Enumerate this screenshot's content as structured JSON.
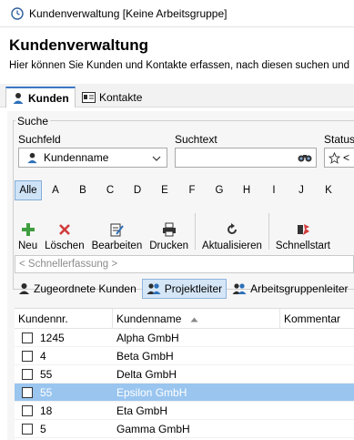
{
  "window": {
    "title": "Kundenverwaltung [Keine Arbeitsgruppe]",
    "icon": "clock-icon"
  },
  "header": {
    "title": "Kundenverwaltung",
    "subtitle": "Hier können Sie Kunden und Kontakte erfassen, nach diesen suchen und"
  },
  "tabs": [
    {
      "label": "Kunden",
      "icon": "customer-icon",
      "active": true
    },
    {
      "label": "Kontakte",
      "icon": "contact-card-icon",
      "active": false
    }
  ],
  "search": {
    "group_label": "Suche",
    "field_label": "Suchfeld",
    "field_value": "Kundenname",
    "text_label": "Suchtext",
    "text_value": "",
    "status_label": "Status",
    "status_value": "<"
  },
  "alphabet": {
    "items": [
      "Alle",
      "A",
      "B",
      "C",
      "D",
      "E",
      "F",
      "G",
      "H",
      "I",
      "J",
      "K"
    ],
    "active": "Alle"
  },
  "toolbar": {
    "new": "Neu",
    "delete": "Löschen",
    "edit": "Bearbeiten",
    "print": "Drucken",
    "refresh": "Aktualisieren",
    "quickstart": "Schnellstart"
  },
  "quickentry": {
    "placeholder": "< Schnellerfassung >"
  },
  "views": [
    {
      "label": "Zugeordnete Kunden",
      "active": false
    },
    {
      "label": "Projektleiter",
      "active": true
    },
    {
      "label": "Arbeitsgruppenleiter",
      "active": false
    }
  ],
  "table": {
    "columns": [
      "Kundennr.",
      "Kundenname",
      "Kommentar"
    ],
    "sort_column": "Kundenname",
    "rows": [
      {
        "nr": "1245",
        "name": "Alpha GmbH",
        "comment": "",
        "selected": false
      },
      {
        "nr": "4",
        "name": "Beta GmbH",
        "comment": "",
        "selected": false
      },
      {
        "nr": "55",
        "name": "Delta GmbH",
        "comment": "",
        "selected": false
      },
      {
        "nr": "55",
        "name": "Epsilon GmbH",
        "comment": "",
        "selected": true
      },
      {
        "nr": "18",
        "name": "Eta GmbH",
        "comment": "",
        "selected": false
      },
      {
        "nr": "5",
        "name": "Gamma GmbH",
        "comment": "",
        "selected": false
      }
    ]
  },
  "colors": {
    "accent": "#3a78c7",
    "selection": "#99c5ef",
    "new_green": "#3f9e3f",
    "delete_red": "#d23c3c"
  }
}
